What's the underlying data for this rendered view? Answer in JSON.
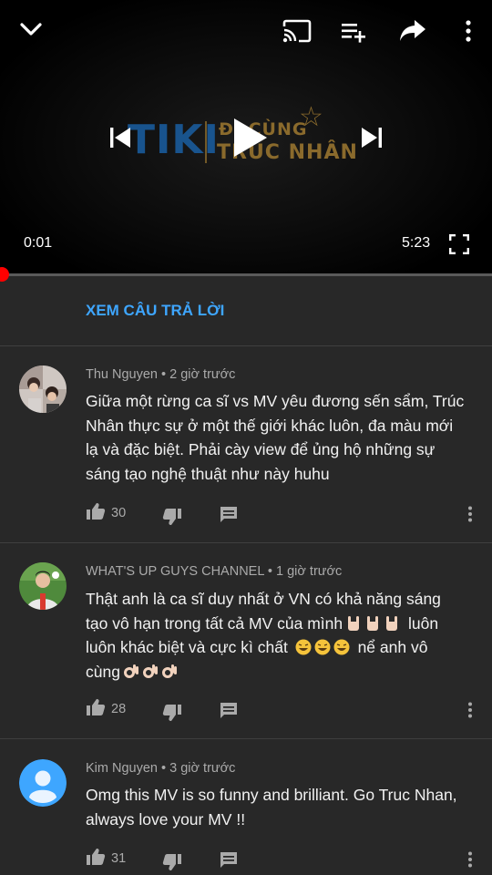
{
  "player": {
    "logo": {
      "brand": "TIKI",
      "line1": "ĐI CÙNG",
      "line2": "TRÚC NHÂN"
    },
    "current_time": "0:01",
    "duration": "5:23",
    "progress_fraction": 0.003,
    "icons": [
      "chevron-down-icon",
      "cast-icon",
      "add-to-playlist-icon",
      "share-icon",
      "more-vert-icon",
      "previous-icon",
      "play-icon",
      "next-icon",
      "fullscreen-icon"
    ]
  },
  "view_replies_label": "XEM CÂU TRẢ LỜI",
  "comments": [
    {
      "author": "Thu Nguyen",
      "time": "2 giờ trước",
      "lines": [
        "Giữa một rừng ca sĩ vs MV yêu đương sến sẩm, Trúc",
        "Nhân thực sự ở một thế giới khác luôn, đa màu mới",
        "lạ và đặc biệt. Phải cày view để ủng hộ những sự",
        "sáng tạo nghệ thuật như này huhu"
      ],
      "likes": "30"
    },
    {
      "author": "WHAT'S UP GUYS CHANNEL",
      "time": "1 giờ trước",
      "lines": [
        "Thật anh là ca sĩ duy nhất ở VN có khả năng sáng",
        "tạo vô hạn trong tất cả MV của mình",
        "luôn",
        "luôn khác biệt và cực kì chất",
        "nể anh vô",
        "cùng"
      ],
      "likes": "28"
    },
    {
      "author": "Kim Nguyen",
      "time": "3 giờ trước",
      "lines": [
        "Omg this MV is so funny and brilliant. Go Truc Nhan,",
        "always love your MV !!"
      ],
      "likes": "31"
    }
  ],
  "colors": {
    "accent_link": "#3ea6ff",
    "progress": "#ff0000",
    "background": "#282828"
  }
}
